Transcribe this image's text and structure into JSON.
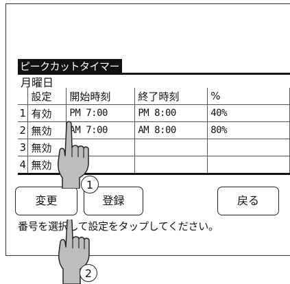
{
  "screen": {
    "title": "ピークカットタイマー",
    "day": "月曜日",
    "hint": "番号を選択して設定をタップしてください。"
  },
  "table": {
    "headers": [
      "",
      "設定",
      "開始時刻",
      "終了時刻",
      "%"
    ],
    "rows": [
      {
        "num": "1",
        "setting": "有効",
        "start": "PM 7:00",
        "end": "PM 8:00",
        "pct": "40%"
      },
      {
        "num": "2",
        "setting": "無効",
        "start": "AM 7:00",
        "end": "AM 8:00",
        "pct": "80%"
      },
      {
        "num": "3",
        "setting": "無効",
        "start": "",
        "end": "",
        "pct": ""
      },
      {
        "num": "4",
        "setting": "無効",
        "start": "",
        "end": "",
        "pct": ""
      }
    ]
  },
  "buttons": {
    "change": "変更",
    "register": "登録",
    "back": "戻る"
  },
  "annotations": {
    "step1": "1",
    "step2": "2"
  },
  "icons": {
    "tap_hand_1": "pointing-hand-icon",
    "tap_hand_2": "pointing-hand-icon"
  },
  "colors": {
    "ink": "#111111",
    "background": "#ffffff",
    "hand_fill": "#bdbdbd"
  }
}
